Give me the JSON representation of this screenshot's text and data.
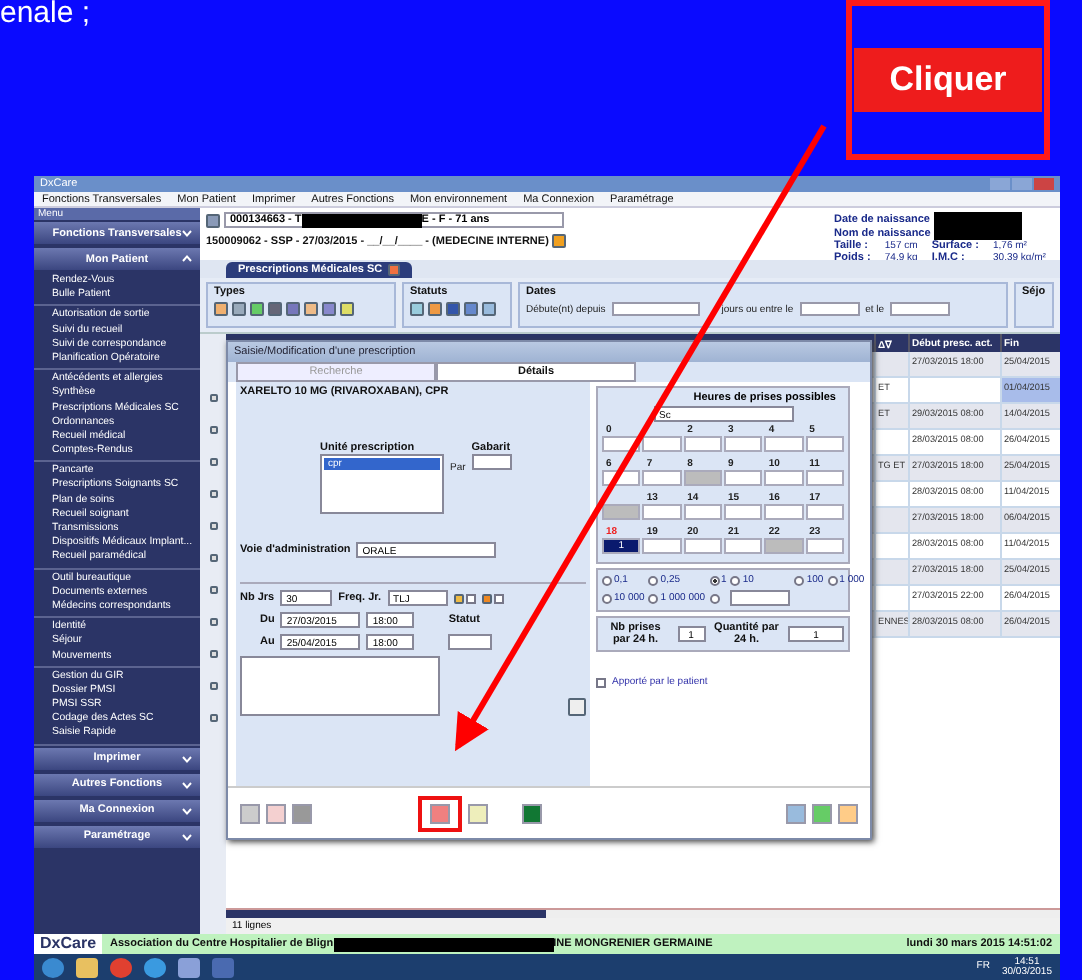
{
  "slide": {
    "caption": "enale ;",
    "callout": "Cliquer"
  },
  "window": {
    "title": "DxCare"
  },
  "menu_bar": [
    "Fonctions Transversales",
    "Mon Patient",
    "Imprimer",
    "Autres Fonctions",
    "Mon environnement",
    "Ma Connexion",
    "Paramétrage"
  ],
  "sidebar": {
    "header": "Menu",
    "sections": [
      {
        "title": "Fonctions Transversales",
        "expanded": false
      },
      {
        "title": "Mon Patient",
        "expanded": true,
        "groups": [
          [
            "Rendez-Vous",
            "Bulle Patient"
          ],
          [
            "Autorisation de sortie",
            "Suivi du recueil",
            "Suivi de correspondance",
            "Planification Opératoire"
          ],
          [
            "Antécédents et allergies",
            "Synthèse",
            "Prescriptions Médicales SC",
            "Ordonnances",
            "Recueil médical",
            "Comptes-Rendus"
          ],
          [
            "Pancarte",
            "Prescriptions Soignants SC",
            "Plan de soins",
            "Recueil soignant",
            "Transmissions",
            "Dispositifs Médicaux Implant...",
            "Recueil paramédical"
          ],
          [
            "Outil bureautique",
            "Documents externes",
            "Médecins correspondants"
          ],
          [
            "Identité",
            "Séjour",
            "Mouvements"
          ],
          [
            "Gestion du GIR",
            "Dossier PMSI",
            "PMSI SSR",
            "Codage des Actes SC",
            "Saisie Rapide"
          ]
        ]
      },
      {
        "title": "Imprimer",
        "expanded": false
      },
      {
        "title": "Autres Fonctions",
        "expanded": false
      },
      {
        "title": "Ma Connexion",
        "expanded": false
      },
      {
        "title": "Paramétrage",
        "expanded": false
      }
    ]
  },
  "patient": {
    "id_start": "000134663 - T",
    "id_end": "E - F - 71 ans",
    "stay": "150009062 - SSP - 27/03/2015 - __/__/____ - (MEDECINE INTERNE)",
    "birth_labels": [
      "Date de naissance",
      "Nom de naissance"
    ],
    "measures": [
      {
        "label": "Taille :",
        "value": "157 cm"
      },
      {
        "label": "Surface :",
        "value": "1,76 m²"
      },
      {
        "label": "Poids :",
        "value": "74,9 kg"
      },
      {
        "label": "I.M.C :",
        "value": "30,39 kg/m²"
      }
    ]
  },
  "tab": "Prescriptions Médicales SC",
  "filters": {
    "types": "Types",
    "statuts": "Statuts",
    "dates": "Dates",
    "since": "Débute(nt) depuis",
    "between": "jours ou entre le",
    "and": "et le",
    "stay": "Séjo"
  },
  "table": {
    "columns": [
      "Δ∇",
      "Début presc. act.",
      "Fin"
    ],
    "rows": [
      {
        "cells": [
          "",
          "27/03/2015 18:00",
          "25/04/2015"
        ],
        "selected": false
      },
      {
        "cells": [
          "ET",
          "",
          "01/04/2015"
        ],
        "selected": true
      },
      {
        "cells": [
          "ET",
          "29/03/2015 08:00",
          "14/04/2015"
        ],
        "selected": false
      },
      {
        "cells": [
          "",
          "28/03/2015 08:00",
          "26/04/2015"
        ],
        "selected": false
      },
      {
        "cells": [
          "TG ET",
          "27/03/2015 18:00",
          "25/04/2015"
        ],
        "selected": false
      },
      {
        "cells": [
          "",
          "28/03/2015 08:00",
          "11/04/2015"
        ],
        "selected": false
      },
      {
        "cells": [
          "",
          "27/03/2015 18:00",
          "06/04/2015"
        ],
        "selected": false
      },
      {
        "cells": [
          "",
          "28/03/2015 08:00",
          "11/04/2015"
        ],
        "selected": false
      },
      {
        "cells": [
          "",
          "27/03/2015 18:00",
          "25/04/2015"
        ],
        "selected": false
      },
      {
        "cells": [
          "",
          "27/03/2015 22:00",
          "26/04/2015"
        ],
        "selected": false
      },
      {
        "cells": [
          "ENNES",
          "28/03/2015 08:00",
          "26/04/2015"
        ],
        "selected": false
      }
    ],
    "footer": "11 lignes"
  },
  "dialog": {
    "title": "Saisie/Modification d'une prescription",
    "tabs": [
      {
        "label": "Recherche",
        "selected": false
      },
      {
        "label": "Détails",
        "selected": true
      }
    ],
    "drug": "XARELTO 10 MG (RIVAROXABAN), CPR",
    "unit_label": "Unité prescription",
    "unit": "cpr",
    "template_label": "Gabarit",
    "per_label": "Par",
    "route_label": "Voie d'administration",
    "route": "ORALE",
    "days_label": "Nb Jrs",
    "days": "30",
    "freq_label": "Freq. Jr.",
    "freq": "TLJ",
    "meal_checks": [
      false,
      false
    ],
    "status_label": "Statut",
    "from_label": "Du",
    "from_date": "27/03/2015",
    "from_time": "18:00",
    "to_label": "Au",
    "to_date": "25/04/2015",
    "to_time": "18:00",
    "hours_title": "Heures de prises possibles",
    "hours_select": "Sc",
    "hours": [
      [
        {
          "h": "0",
          "current": false,
          "selected": false,
          "blocked": false
        },
        {
          "selected": false,
          "blocked": false
        },
        {
          "h": "2",
          "current": false,
          "selected": false,
          "blocked": false
        },
        {
          "h": "3",
          "current": false,
          "selected": false,
          "blocked": false
        },
        {
          "h": "4",
          "current": false,
          "selected": false,
          "blocked": false
        },
        {
          "h": "5",
          "current": false,
          "selected": false,
          "blocked": false
        }
      ],
      [
        {
          "h": "6",
          "current": false,
          "selected": false,
          "blocked": false
        },
        {
          "h": "7",
          "current": false,
          "selected": false,
          "blocked": false
        },
        {
          "h": "8",
          "current": false,
          "selected": false,
          "blocked": true
        },
        {
          "h": "9",
          "current": false,
          "selected": false,
          "blocked": false
        },
        {
          "h": "10",
          "current": false,
          "selected": false,
          "blocked": false
        },
        {
          "h": "11",
          "current": false,
          "selected": false,
          "blocked": false
        }
      ],
      [
        {
          "selected": false,
          "blocked": true
        },
        {
          "h": "13",
          "current": false,
          "selected": false,
          "blocked": false
        },
        {
          "h": "14",
          "current": false,
          "selected": false,
          "blocked": false
        },
        {
          "h": "15",
          "current": false,
          "selected": false,
          "blocked": false
        },
        {
          "h": "16",
          "current": false,
          "selected": false,
          "blocked": false
        },
        {
          "h": "17",
          "current": false,
          "selected": false,
          "blocked": false
        }
      ],
      [
        {
          "h": "18",
          "v": "1",
          "current": true,
          "selected": true,
          "blocked": false
        },
        {
          "h": "19",
          "current": false,
          "selected": false,
          "blocked": false
        },
        {
          "h": "20",
          "current": false,
          "selected": false,
          "blocked": false
        },
        {
          "h": "21",
          "current": false,
          "selected": false,
          "blocked": false
        },
        {
          "h": "22",
          "current": false,
          "selected": false,
          "blocked": true
        },
        {
          "h": "23",
          "current": false,
          "selected": false,
          "blocked": false
        }
      ]
    ],
    "scales": [
      {
        "label": "0,1",
        "selected": false
      },
      {
        "label": "0,25",
        "selected": false
      },
      {
        "label": "1",
        "selected": true
      },
      {
        "label": "10",
        "selected": false
      },
      {
        "label": "100",
        "selected": false
      },
      {
        "label": "1 000",
        "selected": false
      },
      {
        "label": "10 000",
        "selected": false
      },
      {
        "label": "1 000 000",
        "selected": false
      }
    ],
    "other_scale_selected": false,
    "doses_label": "Nb prises par 24 h.",
    "doses": "1",
    "qty_label": "Quantité par 24 h.",
    "qty": "1",
    "brought_label": "Apporté par le patient",
    "brought": false
  },
  "status_bar": {
    "logo": "DxCare",
    "establishment": "Association du Centre Hospitalier de Blign",
    "user": "INE MONGRENIER GERMAINE",
    "datetime": "lundi 30 mars 2015 14:51:02"
  },
  "taskbar": {
    "language": "FR",
    "time": "14:51",
    "date": "30/03/2015"
  }
}
